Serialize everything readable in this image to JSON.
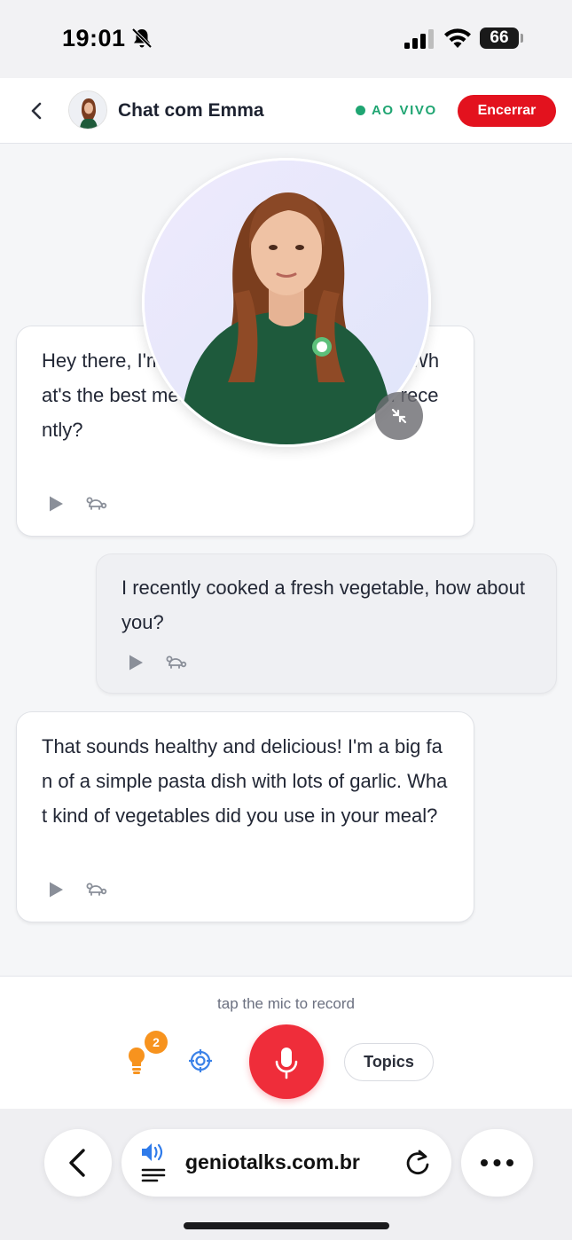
{
  "status_bar": {
    "time": "19:01",
    "battery": "66"
  },
  "header": {
    "title": "Chat com Emma",
    "live_label": "AO VIVO",
    "end_button": "Encerrar",
    "live_color": "#1fa572",
    "end_color": "#e3121e"
  },
  "messages": [
    {
      "role": "bot",
      "text": "Hey there, I'm Emma! Let's kick things off. What's the best meal you've cooked or ate n recently?"
    },
    {
      "role": "user",
      "text": "I recently cooked a fresh vegetable, how about you?"
    },
    {
      "role": "bot",
      "text": "That sounds healthy and delicious! I'm a big fan of a simple pasta dish with lots of garlic. What kind of vegetables did you use in your meal?"
    }
  ],
  "composer": {
    "hint": "tap the mic to record",
    "tips_badge": "2",
    "topics_button": "Topics",
    "mic_color": "#ef2d3a"
  },
  "browser": {
    "url": "geniotalks.com.br"
  },
  "icons": [
    "bell-slash-icon",
    "signal-icon",
    "wifi-icon",
    "chevron-left-icon",
    "play-icon",
    "turtle-icon",
    "minimize-icon",
    "lightbulb-icon",
    "target-icon",
    "microphone-icon",
    "audio-icon",
    "reload-icon",
    "more-icon"
  ]
}
